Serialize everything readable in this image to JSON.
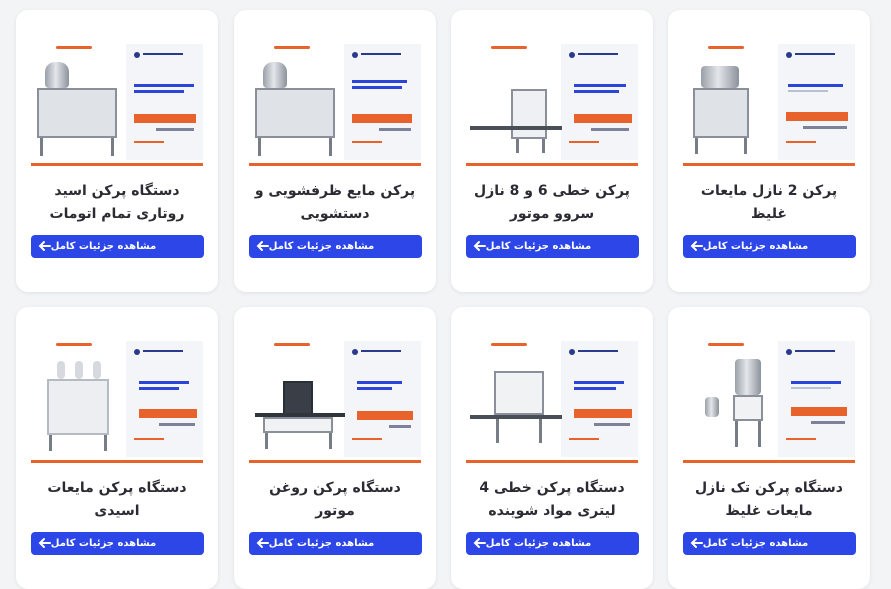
{
  "cards": [
    {
      "title": "پرکن 2 نازل مایعات غلیظ",
      "button": "مشاهده جزئیات کامل"
    },
    {
      "title": "پرکن خطی 6 و 8 نازل سروو موتور",
      "button": "مشاهده جزئیات کامل"
    },
    {
      "title": "پرکن مایع ظرفشویی و دستشویی",
      "button": "مشاهده جزئیات کامل"
    },
    {
      "title": "دستگاه پرکن اسید روتاری تمام اتومات",
      "button": "مشاهده جزئیات کامل"
    },
    {
      "title": "دستگاه پرکن تک نازل مایعات غلیظ",
      "button": "مشاهده جزئیات کامل"
    },
    {
      "title": "دستگاه پرکن خطی 4 لیتری مواد شوینده",
      "button": "مشاهده جزئیات کامل"
    },
    {
      "title": "دستگاه پرکن روغن موتور",
      "button": "مشاهده جزئیات کامل"
    },
    {
      "title": "دستگاه پرکن مایعات اسیدی",
      "button": "مشاهده جزئیات کامل"
    }
  ],
  "colors": {
    "accent": "#2c46e8",
    "banner_orange": "#e8622c"
  },
  "icons": {
    "button_arrow": "arrow-left-icon"
  }
}
